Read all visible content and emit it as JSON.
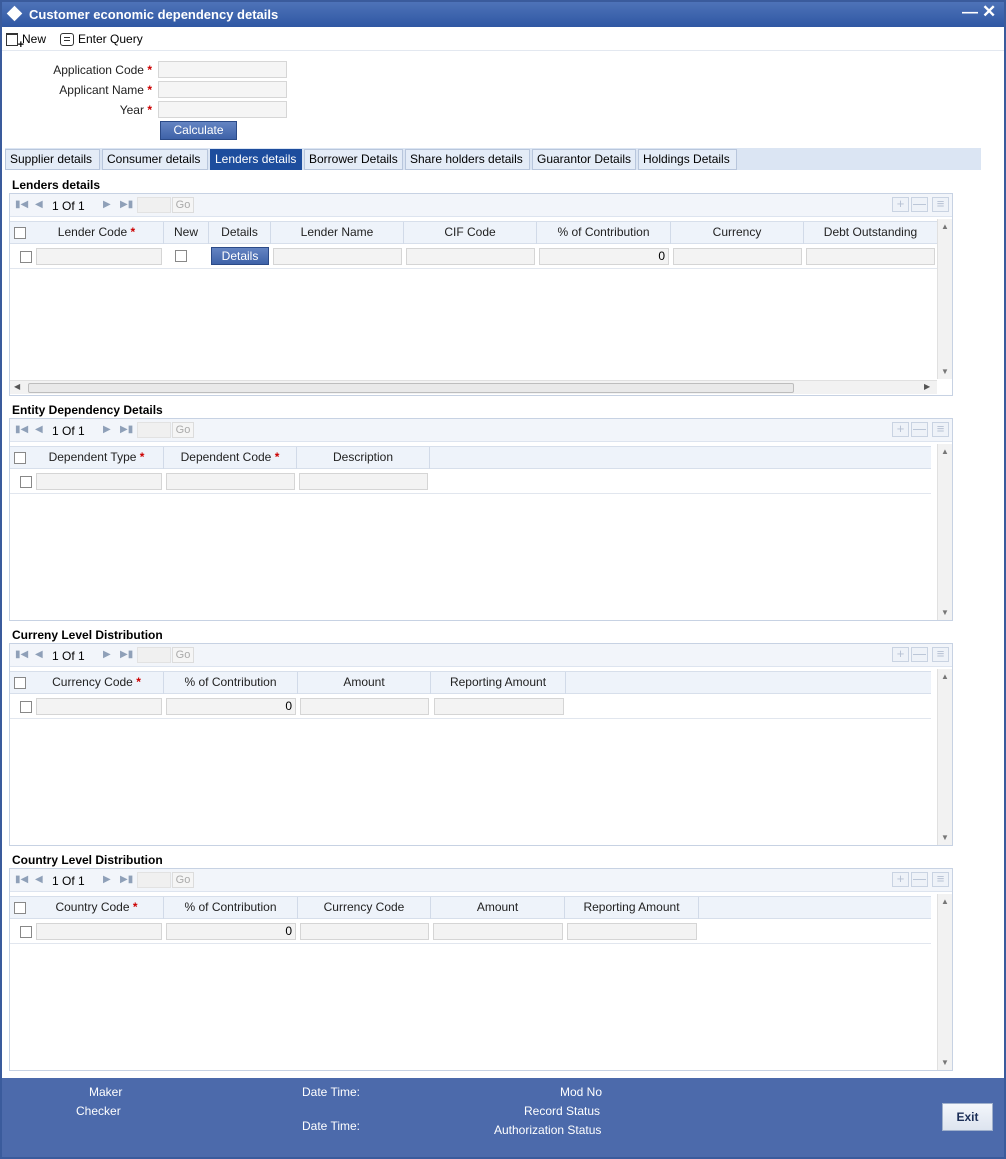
{
  "window": {
    "title": "Customer economic dependency details"
  },
  "toolbar": {
    "new_label": "New",
    "enter_query_label": "Enter Query"
  },
  "form": {
    "application_code_label": "Application Code",
    "applicant_name_label": "Applicant Name",
    "year_label": "Year",
    "required_mark": "*",
    "calculate_label": "Calculate"
  },
  "tabs": [
    "Supplier details",
    "Consumer details",
    "Lenders details",
    "Borrower Details",
    "Share holders details",
    "Guarantor Details",
    "Holdings Details"
  ],
  "active_tab": "Lenders details",
  "nav": {
    "page_text": "1 Of 1",
    "go_label": "Go"
  },
  "lenders": {
    "title": "Lenders details",
    "columns": [
      "Lender Code",
      "New",
      "Details",
      "Lender Name",
      "CIF Code",
      "% of Contribution",
      "Currency",
      "Debt Outstanding"
    ],
    "row": {
      "details_button": "Details",
      "contribution": "0"
    }
  },
  "entity": {
    "title": "Entity Dependency Details",
    "columns": [
      "Dependent Type",
      "Dependent Code",
      "Description"
    ]
  },
  "currency": {
    "title": "Curreny Level Distribution",
    "columns": [
      "Currency Code",
      "% of Contribution",
      "Amount",
      "Reporting Amount"
    ],
    "row": {
      "contribution": "0"
    }
  },
  "country": {
    "title": "Country Level Distribution",
    "columns": [
      "Country Code",
      "% of Contribution",
      "Currency Code",
      "Amount",
      "Reporting Amount"
    ],
    "row": {
      "contribution": "0"
    }
  },
  "footer": {
    "maker": "Maker",
    "checker": "Checker",
    "date_time": "Date Time:",
    "mod_no": "Mod No",
    "record_status": "Record Status",
    "authorization_status": "Authorization Status",
    "exit_label": "Exit"
  },
  "colors": {
    "titlebar": "#2f57a3",
    "active_tab": "#1d4d9d",
    "footer": "#4c6aab",
    "required": "#cc0000"
  }
}
